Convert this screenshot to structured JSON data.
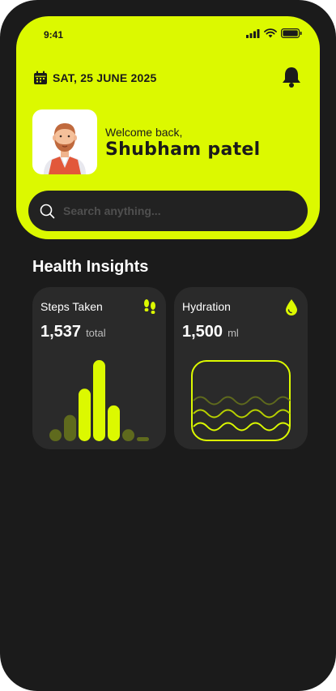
{
  "status_bar": {
    "time": "9:41"
  },
  "header": {
    "date": "SAT, 25 JUNE 2025"
  },
  "user": {
    "welcome": "Welcome back,",
    "name": "Shubham patel"
  },
  "search": {
    "placeholder": "Search anything..."
  },
  "insights": {
    "title": "Health Insights",
    "steps": {
      "title": "Steps Taken",
      "value": "1,537",
      "unit": "total",
      "icon": "footsteps-icon",
      "chart_data": {
        "type": "bar",
        "values": [
          1,
          2.2,
          4.4,
          6.8,
          3,
          1,
          0.3
        ],
        "highlight": [
          false,
          false,
          true,
          true,
          true,
          false,
          false
        ]
      }
    },
    "hydration": {
      "title": "Hydration",
      "value": "1,500",
      "unit": "ml",
      "icon": "water-drop-icon"
    }
  },
  "colors": {
    "accent": "#dcf900",
    "background": "#1b1b1b",
    "card": "#2a2a2a",
    "dim_accent": "#5f6a1d"
  }
}
